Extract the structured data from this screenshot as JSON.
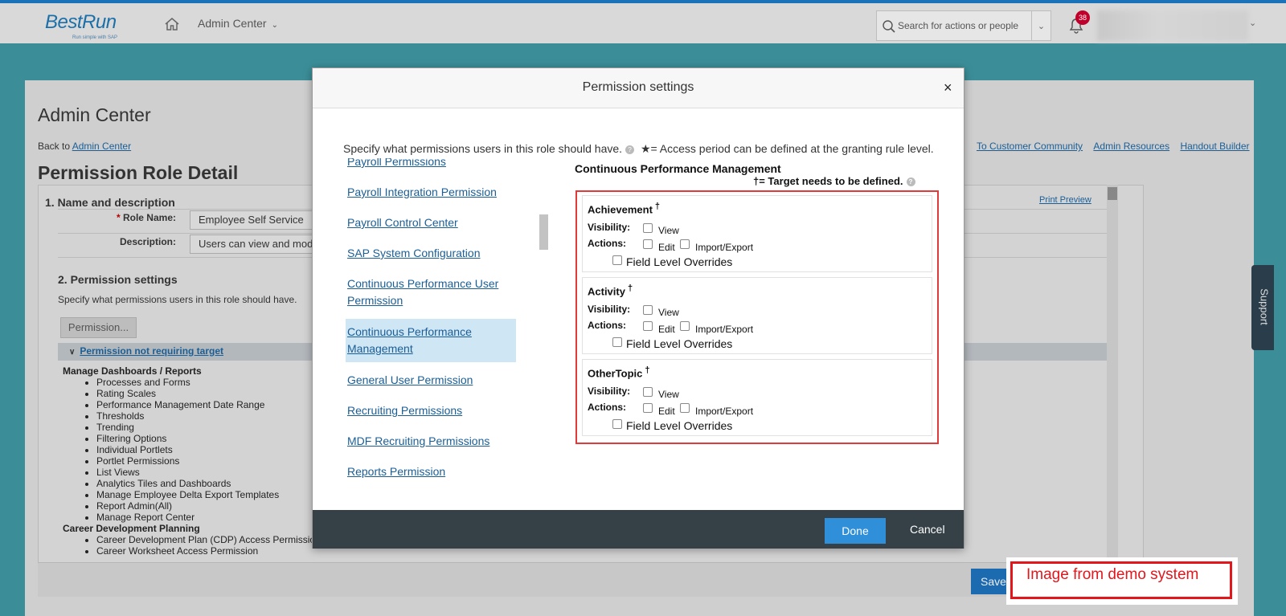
{
  "shell": {
    "logo": "BestRun",
    "logo_tag": "Run simple with SAP",
    "menu": "Admin Center",
    "search_placeholder": "Search for actions or people",
    "notifications": "38"
  },
  "page": {
    "title": "Admin Center",
    "back_prefix": "Back to",
    "back_link": "Admin Center",
    "top_links": [
      "To Customer Community",
      "Admin Resources",
      "Handout Builder"
    ],
    "heading": "Permission Role Detail",
    "section1": "1. Name and description",
    "print_preview": "Print Preview",
    "role_name_label": "Role Name:",
    "role_name_value": "Employee Self Service",
    "description_label": "Description:",
    "description_value": "Users can view and mod",
    "section2": "2. Permission settings",
    "section2_desc": "Specify what permissions users in this role should have.",
    "permission_button": "Permission...",
    "panel_header": "Permission not requiring target",
    "groups": [
      {
        "name": "Manage Dashboards / Reports",
        "items": [
          "Processes and Forms",
          "Rating Scales",
          "Performance Management Date Range",
          "Thresholds",
          "Trending",
          "Filtering Options",
          "Individual Portlets",
          "Portlet Permissions",
          "List Views",
          "Analytics Tiles and Dashboards",
          "Manage Employee Delta Export Templates",
          "Report Admin(All)",
          "Manage Report Center"
        ]
      },
      {
        "name": "Career Development Planning",
        "items": [
          "Career Development Plan (CDP) Access Permission",
          "Career Worksheet Access Permission"
        ]
      }
    ],
    "save_label": "Save",
    "support": "Support"
  },
  "modal": {
    "title": "Permission settings",
    "close": "×",
    "intro": "Specify what permissions users in this role should have.",
    "access_note": "★= Access period can be defined at the granting rule level.",
    "categories": [
      "Payroll Permissions",
      "Payroll Integration Permission",
      "Payroll Control Center",
      "SAP System Configuration",
      "Continuous Performance User Permission",
      "Continuous Performance Management",
      "General User Permission",
      "Recruiting Permissions",
      "MDF Recruiting Permissions",
      "Reports Permission"
    ],
    "selected_category": "Continuous Performance Management",
    "section_title": "Continuous Performance Management",
    "target_note": "†= Target needs to be defined.",
    "dagger": "†",
    "visibility_label": "Visibility:",
    "actions_label": "Actions:",
    "view_label": "View",
    "edit_label": "Edit",
    "import_export_label": "Import/Export",
    "field_level_label": "Field Level Overrides",
    "groups": [
      {
        "name": "Achievement"
      },
      {
        "name": "Activity"
      },
      {
        "name": "OtherTopic"
      }
    ],
    "done": "Done",
    "cancel": "Cancel"
  },
  "watermark": "Image from demo system",
  "colors": {
    "accent": "#2f8fd8",
    "link": "#1b5e95",
    "highlight_border": "#e03a3a",
    "footer": "#354047"
  }
}
